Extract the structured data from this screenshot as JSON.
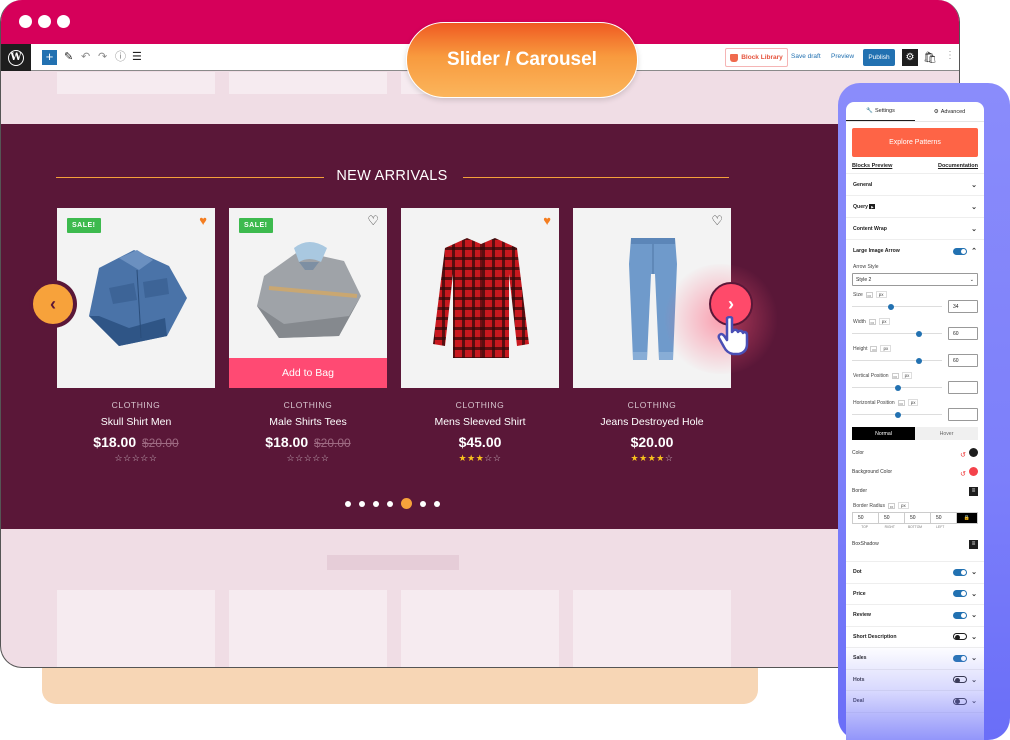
{
  "badge": {
    "label": "Slider / Carousel"
  },
  "toolbar": {
    "block_library": "Block Library",
    "save_draft": "Save draft",
    "preview": "Preview",
    "publish": "Publish"
  },
  "hero": {
    "title": "NEW ARRIVALS",
    "products": [
      {
        "sale": "SALE!",
        "wishlisted": true,
        "category": "CLOTHING",
        "name": "Skull Shirt Men",
        "price": "$18.00",
        "old_price": "$20.00",
        "rating": 0,
        "image": "denim-shirt"
      },
      {
        "sale": "SALE!",
        "wishlisted": false,
        "category": "CLOTHING",
        "name": "Male Shirts Tees",
        "price": "$18.00",
        "old_price": "$20.00",
        "rating": 0,
        "image": "grey-shirt",
        "add_to_bag": "Add to Bag"
      },
      {
        "sale": null,
        "wishlisted": true,
        "category": "CLOTHING",
        "name": "Mens Sleeved Shirt",
        "price": "$45.00",
        "old_price": null,
        "rating": 3,
        "image": "red-plaid-shirt"
      },
      {
        "sale": null,
        "wishlisted": false,
        "category": "CLOTHING",
        "name": "Jeans Destroyed Hole",
        "price": "$20.00",
        "old_price": null,
        "rating": 4,
        "image": "blue-jeans"
      }
    ],
    "pagination": {
      "count": 7,
      "active": 5
    }
  },
  "panel": {
    "tabs": [
      {
        "label": "Settings",
        "icon": "wrench-icon",
        "active": true
      },
      {
        "label": "Advanced",
        "icon": "gear-icon",
        "active": false
      }
    ],
    "explore": "Explore Patterns",
    "blocks_preview": "Blocks Preview",
    "documentation": "Documentation",
    "sections_top": [
      {
        "label": "General"
      },
      {
        "label": "Query"
      },
      {
        "label": "Content Wrap"
      }
    ],
    "large_image_arrow": {
      "label": "Large Image Arrow",
      "enabled": true,
      "arrow_style_label": "Arrow Style",
      "arrow_style_value": "Style 2",
      "size_label": "Size",
      "size_unit": "px",
      "size_value": "34",
      "width_label": "Width",
      "width_unit": "px",
      "width_value": "60",
      "height_label": "Height",
      "height_unit": "px",
      "height_value": "60",
      "vpos_label": "Vertical Position",
      "vpos_unit": "px",
      "vpos_value": "",
      "hpos_label": "Horizontal Position",
      "hpos_unit": "px",
      "hpos_value": "",
      "state_normal": "Normal",
      "state_hover": "Hover",
      "color_label": "Color",
      "color_value": "#1e1e1e",
      "bg_color_label": "Background Color",
      "bg_color_value": "#f4424b",
      "border_label": "Border",
      "border_radius_label": "Border Radius",
      "border_radius_unit": "px",
      "radius": {
        "top": "50",
        "right": "50",
        "bottom": "50",
        "left": "50"
      },
      "radius_labels": {
        "top": "TOP",
        "right": "RIGHT",
        "bottom": "BOTTOM",
        "left": "LEFT"
      },
      "boxshadow_label": "BoxShadow"
    },
    "sections_bottom": [
      {
        "label": "Dot",
        "enabled": true
      },
      {
        "label": "Price",
        "enabled": true
      },
      {
        "label": "Review",
        "enabled": true
      },
      {
        "label": "Short Description",
        "enabled": false
      },
      {
        "label": "Sales",
        "enabled": true
      },
      {
        "label": "Hots",
        "enabled": false
      },
      {
        "label": "Deal",
        "enabled": false
      }
    ]
  },
  "colors": {
    "titlebar": "#d6005a",
    "hero_bg": "#5a1738",
    "accent_orange": "#f7a23b",
    "add_to_bag": "#ff4a73",
    "explore": "#fe6446",
    "wp_blue": "#2271b1"
  }
}
